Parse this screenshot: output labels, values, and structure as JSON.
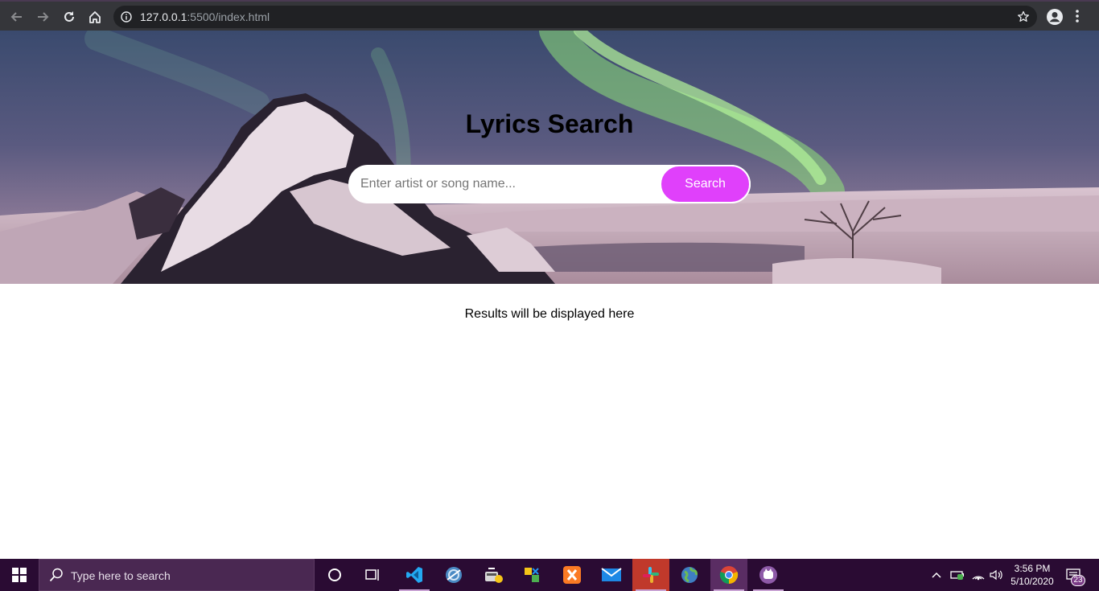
{
  "browser": {
    "url_host": "127.0.0.1",
    "url_rest": ":5500/index.html",
    "icons": [
      "back-arrow-icon",
      "forward-arrow-icon",
      "reload-icon",
      "home-icon",
      "info-icon",
      "bookmark-star-icon",
      "profile-icon",
      "kebab-menu-icon"
    ]
  },
  "hero": {
    "title": "Lyrics Search",
    "search": {
      "placeholder": "Enter artist or song name...",
      "value": "",
      "button_label": "Search"
    }
  },
  "results": {
    "text": "Results will be displayed here"
  },
  "taskbar": {
    "search_placeholder": "Type here to search",
    "apps": [
      "cortana-icon",
      "task-view-icon",
      "vscode-icon",
      "app-icon",
      "app-icon",
      "app-icon",
      "xampp-icon",
      "mail-icon",
      "slack-icon",
      "globe-icon",
      "chrome-icon",
      "app-icon"
    ],
    "clock": {
      "time": "3:56 PM",
      "date": "5/10/2020"
    },
    "notification_count": "23"
  },
  "colors": {
    "accent": "#e040fb",
    "chrome_bg": "#35363a",
    "taskbar_bg": "#2a0b33"
  }
}
